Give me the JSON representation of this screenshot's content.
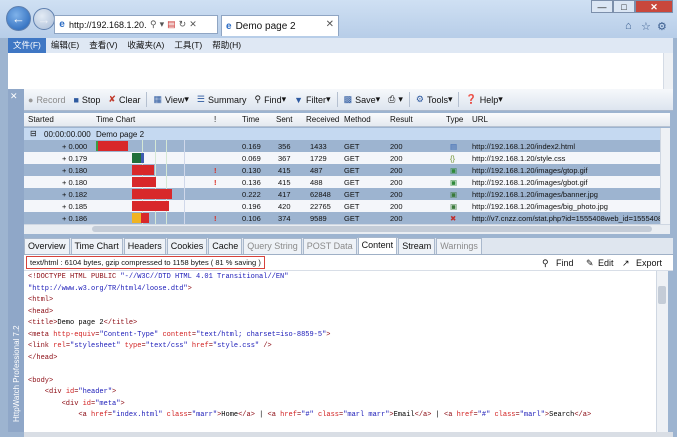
{
  "browser": {
    "address": "http://192.168.1.20.",
    "tab_title": "Demo page 2",
    "menus": [
      "文件(F)",
      "编辑(E)",
      "查看(V)",
      "收藏夹(A)",
      "工具(T)",
      "帮助(H)"
    ]
  },
  "httpwatch": {
    "sidebar_label": "HttpWatch Professional 7.2",
    "toolbar": {
      "record": "Record",
      "stop": "Stop",
      "clear": "Clear",
      "view": "View",
      "summary": "Summary",
      "find": "Find",
      "filter": "Filter",
      "save": "Save",
      "tools": "Tools",
      "help": "Help"
    },
    "columns": [
      "Started",
      "Time Chart",
      "!",
      "Time",
      "Sent",
      "Received",
      "Method",
      "Result",
      "Type",
      "URL"
    ],
    "group": {
      "toggle": "⊟",
      "started": "00:00:00.000",
      "title": "Demo page 2"
    },
    "rows": [
      {
        "started": "+ 0.000",
        "warn": "",
        "time": "0.169",
        "sent": "356",
        "received": "1433",
        "method": "GET",
        "result": "200",
        "type_icon": "html-icon",
        "url": "http://192.168.1.20/index2.html"
      },
      {
        "started": "+ 0.179",
        "warn": "",
        "time": "0.069",
        "sent": "367",
        "received": "1729",
        "method": "GET",
        "result": "200",
        "type_icon": "css-icon",
        "url": "http://192.168.1.20/style.css"
      },
      {
        "started": "+ 0.180",
        "warn": "!",
        "time": "0.130",
        "sent": "415",
        "received": "487",
        "method": "GET",
        "result": "200",
        "type_icon": "gif-icon",
        "url": "http://192.168.1.20/images/gtop.gif"
      },
      {
        "started": "+ 0.180",
        "warn": "!",
        "time": "0.136",
        "sent": "415",
        "received": "488",
        "method": "GET",
        "result": "200",
        "type_icon": "gif-icon",
        "url": "http://192.168.1.20/images/gbot.gif"
      },
      {
        "started": "+ 0.182",
        "warn": "",
        "time": "0.222",
        "sent": "417",
        "received": "62848",
        "method": "GET",
        "result": "200",
        "type_icon": "jpg-icon",
        "url": "http://192.168.1.20/images/banner.jpg"
      },
      {
        "started": "+ 0.185",
        "warn": "",
        "time": "0.196",
        "sent": "420",
        "received": "22765",
        "method": "GET",
        "result": "200",
        "type_icon": "jpg-icon",
        "url": "http://192.168.1.20/images/big_photo.jpg"
      },
      {
        "started": "+ 0.186",
        "warn": "!",
        "time": "0.106",
        "sent": "374",
        "received": "9589",
        "method": "GET",
        "result": "200",
        "type_icon": "redirect-icon",
        "url": "http://v7.cnzz.com/stat.php?id=1555408web_id=1555408"
      }
    ],
    "detail_tabs": [
      "Overview",
      "Time Chart",
      "Headers",
      "Cookies",
      "Cache",
      "Query String",
      "POST Data",
      "Content",
      "Stream",
      "Warnings"
    ],
    "active_tab": "Content",
    "content_info": "text/html : 6104 bytes, gzip compressed to 1158 bytes ( 81 % saving )",
    "content_actions": {
      "find": "Find",
      "edit": "Edit",
      "export": "Export"
    },
    "source_lines": [
      [
        [
          "tg",
          "<!DOCTYPE HTML PUBLIC "
        ],
        [
          "st",
          "\"-//W3C//DTD HTML 4.01 Transitional//EN\""
        ]
      ],
      [
        [
          "st",
          "\"http://www.w3.org/TR/html4/loose.dtd\""
        ],
        [
          "tg",
          ">"
        ]
      ],
      [
        [
          "tg",
          "<html>"
        ]
      ],
      [
        [
          "tg",
          "<head>"
        ]
      ],
      [
        [
          "tg",
          "<title>"
        ],
        [
          "tx",
          "Demo page 2"
        ],
        [
          "tg",
          "</title>"
        ]
      ],
      [
        [
          "tg",
          "<meta "
        ],
        [
          "at",
          "http-equiv"
        ],
        [
          "tg",
          "="
        ],
        [
          "st",
          "\"Content-Type\""
        ],
        [
          "tg",
          " "
        ],
        [
          "at",
          "content"
        ],
        [
          "tg",
          "="
        ],
        [
          "st",
          "\"text/html; charset=iso-8859-5\""
        ],
        [
          "tg",
          ">"
        ]
      ],
      [
        [
          "tg",
          "<link "
        ],
        [
          "at",
          "rel"
        ],
        [
          "tg",
          "="
        ],
        [
          "st",
          "\"stylesheet\""
        ],
        [
          "tg",
          " "
        ],
        [
          "at",
          "type"
        ],
        [
          "tg",
          "="
        ],
        [
          "st",
          "\"text/css\""
        ],
        [
          "tg",
          " "
        ],
        [
          "at",
          "href"
        ],
        [
          "tg",
          "="
        ],
        [
          "st",
          "\"style.css\""
        ],
        [
          "tg",
          " />"
        ]
      ],
      [
        [
          "tg",
          "</head>"
        ]
      ],
      [
        [
          "tx",
          ""
        ]
      ],
      [
        [
          "tg",
          "<body>"
        ]
      ],
      [
        [
          "tg",
          "    <div "
        ],
        [
          "at",
          "id"
        ],
        [
          "tg",
          "="
        ],
        [
          "st",
          "\"header\""
        ],
        [
          "tg",
          ">"
        ]
      ],
      [
        [
          "tg",
          "        <div "
        ],
        [
          "at",
          "id"
        ],
        [
          "tg",
          "="
        ],
        [
          "st",
          "\"meta\""
        ],
        [
          "tg",
          ">"
        ]
      ],
      [
        [
          "tg",
          "            <a "
        ],
        [
          "at",
          "href"
        ],
        [
          "tg",
          "="
        ],
        [
          "st",
          "\"index.html\""
        ],
        [
          "tg",
          " "
        ],
        [
          "at",
          "class"
        ],
        [
          "tg",
          "="
        ],
        [
          "st",
          "\"marr\""
        ],
        [
          "tg",
          ">"
        ],
        [
          "tx",
          "Home"
        ],
        [
          "tg",
          "</a>"
        ],
        [
          "tx",
          " | "
        ],
        [
          "tg",
          "<a "
        ],
        [
          "at",
          "href"
        ],
        [
          "tg",
          "="
        ],
        [
          "st",
          "\"#\""
        ],
        [
          "tg",
          " "
        ],
        [
          "at",
          "class"
        ],
        [
          "tg",
          "="
        ],
        [
          "st",
          "\"marl marr\""
        ],
        [
          "tg",
          ">"
        ],
        [
          "tx",
          "Email"
        ],
        [
          "tg",
          "</a>"
        ],
        [
          "tx",
          " | "
        ],
        [
          "tg",
          "<a "
        ],
        [
          "at",
          "href"
        ],
        [
          "tg",
          "="
        ],
        [
          "st",
          "\"#\""
        ],
        [
          "tg",
          " "
        ],
        [
          "at",
          "class"
        ],
        [
          "tg",
          "="
        ],
        [
          "st",
          "\"marl\""
        ],
        [
          "tg",
          ">"
        ],
        [
          "tx",
          "Search"
        ],
        [
          "tg",
          "</a>"
        ]
      ]
    ]
  }
}
